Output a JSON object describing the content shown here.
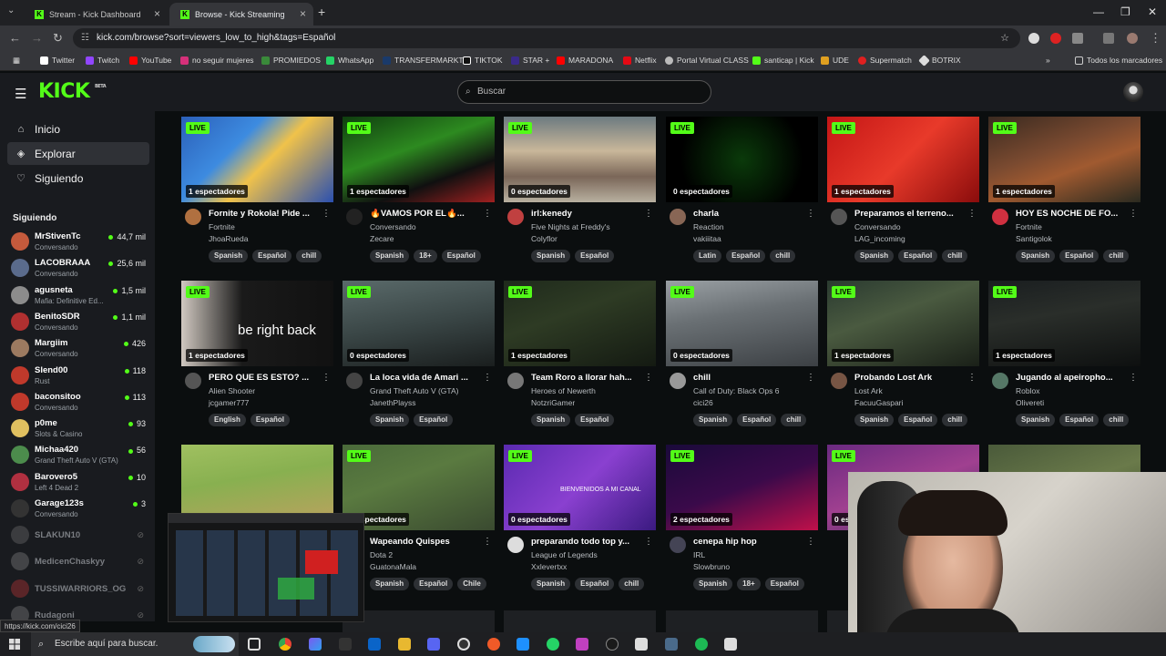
{
  "browser": {
    "tabs": [
      {
        "title": "Stream - Kick Dashboard",
        "active": false
      },
      {
        "title": "Browse - Kick Streaming",
        "active": true
      }
    ],
    "url": "kick.com/browse?sort=viewers_low_to_high&tags=Español",
    "bookmarks": [
      "Twitter",
      "Twitch",
      "YouTube",
      "no seguir mujeres",
      "PROMIEDOS",
      "WhatsApp",
      "TRANSFERMARKT",
      "TIKTOK",
      "STAR +",
      "MARADONA",
      "Netflix",
      "Portal Virtual CLASS",
      "santicap | Kick",
      "UDE",
      "Supermatch",
      "BOTRIX"
    ],
    "bookmarks_folder": "Todos los marcadores",
    "status_url": "https://kick.com/cici26"
  },
  "kick": {
    "logo": "KICK",
    "logo_badge": "BETA",
    "search_placeholder": "Buscar",
    "nav": [
      {
        "label": "Inicio",
        "icon": "home-icon"
      },
      {
        "label": "Explorar",
        "icon": "compass-icon",
        "active": true
      },
      {
        "label": "Siguiendo",
        "icon": "heart-icon"
      }
    ],
    "following_title": "Siguiendo",
    "following": [
      {
        "name": "MrStivenTc",
        "category": "Conversando",
        "viewers": "44,7 mil",
        "color": "#c45a3c"
      },
      {
        "name": "LACOBRAAA",
        "category": "Conversando",
        "viewers": "25,6 mil",
        "color": "#5a6b8c"
      },
      {
        "name": "agusneta",
        "category": "Mafia: Definitive Ed...",
        "viewers": "1,5 mil",
        "color": "#8c8c8c"
      },
      {
        "name": "BenitoSDR",
        "category": "Conversando",
        "viewers": "1,1 mil",
        "color": "#b03030"
      },
      {
        "name": "Margiim",
        "category": "Conversando",
        "viewers": "426",
        "color": "#9c7a60"
      },
      {
        "name": "Slend00",
        "category": "Rust",
        "viewers": "118",
        "color": "#c0392b"
      },
      {
        "name": "baconsitoo",
        "category": "Conversando",
        "viewers": "113",
        "color": "#c0392b"
      },
      {
        "name": "p0me",
        "category": "Slots & Casino",
        "viewers": "93",
        "color": "#e0c060"
      },
      {
        "name": "Michaa420",
        "category": "Grand Theft Auto V (GTA)",
        "viewers": "56",
        "color": "#4c8c4c"
      },
      {
        "name": "Barovero5",
        "category": "Left 4 Dead 2",
        "viewers": "10",
        "color": "#b03040"
      },
      {
        "name": "Garage123s",
        "category": "Conversando",
        "viewers": "3",
        "color": "#333333"
      }
    ],
    "following_offline": [
      {
        "name": "SLAKUN10",
        "color": "#666"
      },
      {
        "name": "MedicenChaskyy",
        "color": "#777"
      },
      {
        "name": "TUSSIWARRIORS_OG",
        "color": "#aa3333"
      },
      {
        "name": "Rudagoni",
        "color": "#777"
      }
    ],
    "live_label": "LIVE",
    "streams": [
      {
        "title": "Fornite y Rokola! Pide ...",
        "category": "Fortnite",
        "user": "JhoaRueda",
        "viewers": "1 espectadores",
        "tags": [
          "Spanish",
          "Español",
          "chill"
        ],
        "thumb": "linear-gradient(135deg,#2b5fb8 0%,#3d8be0 35%,#f0c24a 55%,#2a4fb0 100%)",
        "avatar": "#b07040"
      },
      {
        "title": "🔥VAMOS POR EL🔥...",
        "category": "Conversando",
        "user": "Zecare",
        "viewers": "1 espectadores",
        "tags": [
          "Spanish",
          "18+",
          "Español"
        ],
        "thumb": "linear-gradient(160deg,#0f3d0f 0%,#2d8a20 40%,#101010 70%,#a02020 100%)",
        "avatar": "#222"
      },
      {
        "title": "irl:kenedy",
        "category": "Five Nights at Freddy's",
        "user": "Colyflor",
        "viewers": "0 espectadores",
        "tags": [
          "Spanish",
          "Español"
        ],
        "thumb": "linear-gradient(180deg,#6c7a80 0%,#c9b79a 40%,#7a6658 70%,#b8b0a0 100%)",
        "avatar": "#c04040"
      },
      {
        "title": "charla",
        "category": "Reaction",
        "user": "vakiiitaa",
        "viewers": "0 espectadores",
        "tags": [
          "Latin",
          "Español",
          "chill"
        ],
        "thumb": "radial-gradient(circle at 50% 50%,#0a3a0a 0%,#000 70%)",
        "avatar": "#886655"
      },
      {
        "title": "Preparamos el terreno...",
        "category": "Conversando",
        "user": "LAG_incoming",
        "viewers": "1 espectadores",
        "tags": [
          "Spanish",
          "Español",
          "chill"
        ],
        "thumb": "linear-gradient(135deg,#c41616 0%,#e83a2a 50%,#8a0c0c 100%)",
        "avatar": "#555"
      },
      {
        "title": "HOY ES NOCHE DE FO...",
        "category": "Fortnite",
        "user": "Santigolok",
        "viewers": "1 espectadores",
        "tags": [
          "Spanish",
          "Español",
          "chill"
        ],
        "thumb": "linear-gradient(160deg,#3a2a20 0%,#7a4a30 40%,#a05a30 60%,#2a2a20 100%)",
        "avatar": "#d03040"
      },
      {
        "title": "PERO QUE ES ESTO? ...",
        "category": "Alien Shooter",
        "user": "jcgamer777",
        "viewers": "1 espectadores",
        "tags": [
          "English",
          "Español"
        ],
        "thumb": "linear-gradient(90deg,#d0c8c0 0%,#1a1a1a 40%,#111 100%)",
        "overlay": "be right back",
        "avatar": "#555"
      },
      {
        "title": "La loca vida de Amari ...",
        "category": "Grand Theft Auto V (GTA)",
        "user": "JanethPlayss",
        "viewers": "0 espectadores",
        "tags": [
          "Spanish",
          "Español"
        ],
        "thumb": "linear-gradient(170deg,#5a6a6a 0%,#3a4646 50%,#1a1e1e 100%)",
        "avatar": "#444"
      },
      {
        "title": "Team Roro a llorar hah...",
        "category": "Heroes of Newerth",
        "user": "NotzriGamer",
        "viewers": "1 espectadores",
        "tags": [
          "Spanish",
          "Español"
        ],
        "thumb": "linear-gradient(160deg,#1f2a1c 0%,#2e3b24 40%,#141a12 100%)",
        "avatar": "#777"
      },
      {
        "title": "chill",
        "category": "Call of Duty: Black Ops 6",
        "user": "cici26",
        "viewers": "0 espectadores",
        "tags": [
          "Spanish",
          "Español",
          "chill"
        ],
        "thumb": "linear-gradient(170deg,#9aa0a4 0%,#6a7074 40%,#3c4044 100%)",
        "avatar": "#999"
      },
      {
        "title": "Probando Lost Ark",
        "category": "Lost Ark",
        "user": "FacuuGaspari",
        "viewers": "1 espectadores",
        "tags": [
          "Spanish",
          "Español",
          "chill"
        ],
        "thumb": "linear-gradient(160deg,#2a3a30 0%,#4a5a40 40%,#1a2018 100%)",
        "avatar": "#775544"
      },
      {
        "title": "Jugando al apeiropho...",
        "category": "Roblox",
        "user": "Olivereti",
        "viewers": "1 espectadores",
        "tags": [
          "Spanish",
          "Español",
          "chill"
        ],
        "thumb": "linear-gradient(170deg,#1a1e20 0%,#2a2e2a 40%,#0e1010 100%)",
        "avatar": "#557766"
      },
      {
        "title": "",
        "category": "",
        "user": "",
        "viewers": "",
        "tags": [],
        "thumb": "linear-gradient(170deg,#a0c060 0%,#88b050 40%,#c0a060 100%)",
        "avatar": "#333"
      },
      {
        "title": "Wapeando Quispes",
        "category": "Dota 2",
        "user": "GuatonaMala",
        "viewers": "0 espectadores",
        "tags": [
          "Spanish",
          "Español",
          "Chile"
        ],
        "thumb": "linear-gradient(160deg,#4a6a3a 0%,#5a7a40 40%,#3a4a30 100%)",
        "avatar": "#444"
      },
      {
        "title": "preparando todo top y...",
        "category": "League of Legends",
        "user": "Xxlevertxx",
        "viewers": "0 espectadores",
        "tags": [
          "Spanish",
          "Español",
          "chill"
        ],
        "thumb": "linear-gradient(135deg,#5a2ab0 0%,#8a40d0 50%,#3a1a80 100%)",
        "overlay": "BIENVENIDOS A MI CANAL",
        "avatar": "#ddd"
      },
      {
        "title": "cenepa hip hop",
        "category": "IRL",
        "user": "Slowbruno",
        "viewers": "2 espectadores",
        "tags": [
          "Spanish",
          "18+",
          "Español"
        ],
        "thumb": "linear-gradient(160deg,#1a0a3a 0%,#3a0a4a 50%,#c0104a 100%)",
        "avatar": "#445"
      },
      {
        "title": "",
        "category": "",
        "user": "",
        "viewers": "0 es",
        "tags": [],
        "thumb": "linear-gradient(160deg,#6a2a80 0%,#a04090 50%,#3a2a60 100%)",
        "avatar": "#6688aa"
      },
      {
        "title": "",
        "category": "",
        "user": "",
        "viewers": "",
        "tags": [],
        "thumb": "linear-gradient(160deg,#4a5a3a 0%,#6a7a4a 50%,#3a4a2a 100%)",
        "avatar": "#333"
      }
    ]
  },
  "taskbar": {
    "search_placeholder": "Escribe aquí para buscar."
  }
}
